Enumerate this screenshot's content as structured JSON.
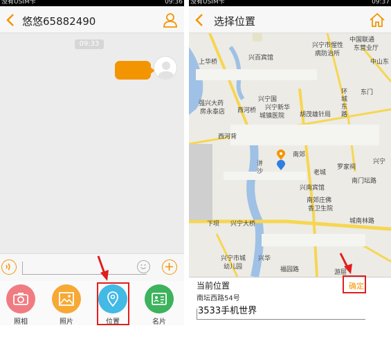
{
  "left_screen": {
    "status": {
      "carrier": "没有USIM卡",
      "time": "09:36"
    },
    "header": {
      "title": "悠悠65882490"
    },
    "chat": {
      "timestamp": "09:33"
    },
    "tray": {
      "items": [
        {
          "label": "照相",
          "icon": "camera-icon",
          "color": "#f07c82"
        },
        {
          "label": "照片",
          "icon": "photo-icon",
          "color": "#f6a934"
        },
        {
          "label": "位置",
          "icon": "location-pin-icon",
          "color": "#43b9e6"
        },
        {
          "label": "名片",
          "icon": "contact-card-icon",
          "color": "#3cb35c"
        }
      ]
    }
  },
  "right_screen": {
    "status": {
      "carrier": "没有USIM卡",
      "time": "09:37"
    },
    "header": {
      "title": "选择位置"
    },
    "map": {
      "labels": [
        "中国联通",
        "东营业厅",
        "兴宁市惺性",
        "病防治所",
        "兴百宾馆",
        "中山东",
        "上华桥",
        "东门",
        "环城东路",
        "兴宁国",
        "强兴大药",
        "房永泰店",
        "西河桥",
        "兴宁新华",
        "城镇医院",
        "胡茂雄针局",
        "西河背",
        "南郊",
        "洴沙",
        "罗家祠",
        "兴宁",
        "南门坛路",
        "兴南宾馆",
        "南郊庄佛",
        "香卫生院",
        "老城",
        "下坝",
        "兴宁大桥",
        "城南林路",
        "兴宁市城",
        "幼儿园",
        "兴华",
        "福园路",
        "游层"
      ]
    },
    "panel": {
      "title": "当前位置",
      "address": "南坛西路54号",
      "input_value": "3533手机世界",
      "confirm": "确定"
    }
  },
  "colors": {
    "accent": "#f39500",
    "highlight": "#e21d1d",
    "road": "#f6d652",
    "water": "#9fc1e5"
  }
}
